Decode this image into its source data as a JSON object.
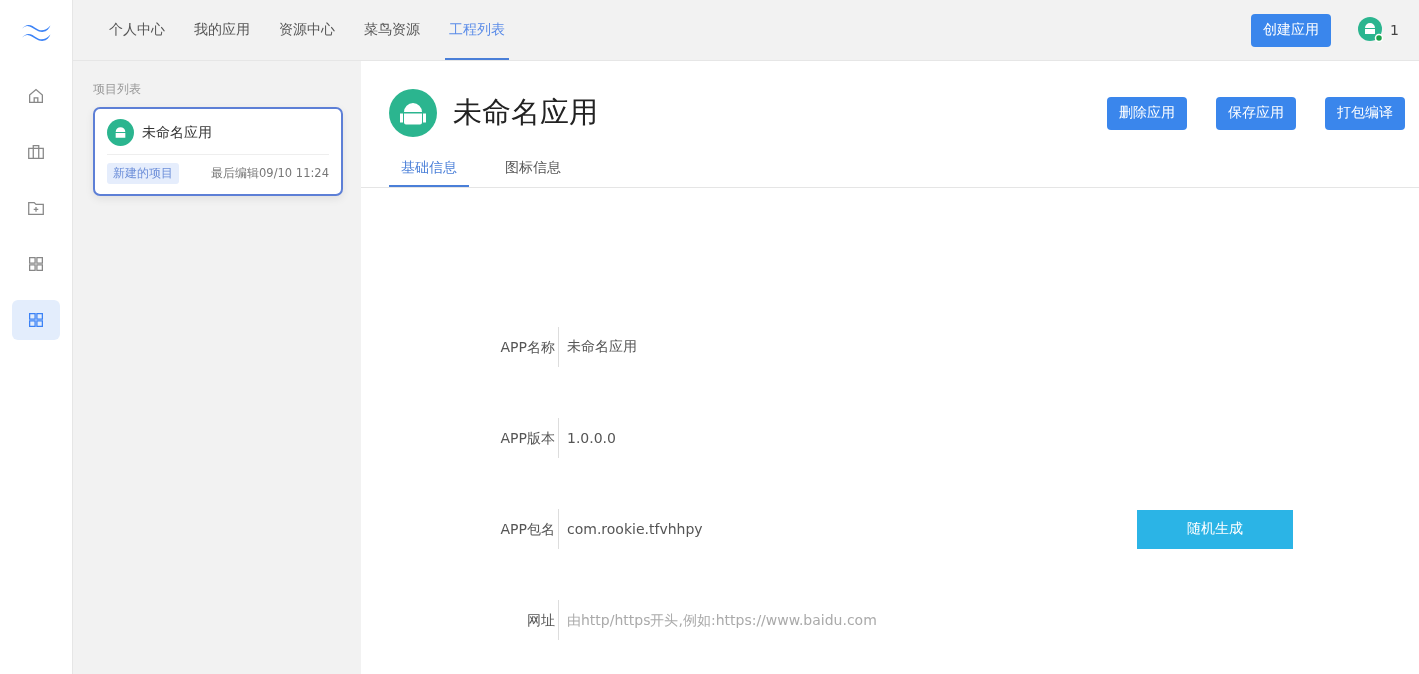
{
  "top_nav": {
    "items": [
      {
        "label": "个人中心",
        "selected": false
      },
      {
        "label": "我的应用",
        "selected": false
      },
      {
        "label": "资源中心",
        "selected": false
      },
      {
        "label": "菜鸟资源",
        "selected": false
      },
      {
        "label": "工程列表",
        "selected": true
      }
    ],
    "create_button": "创建应用",
    "user_count": "1"
  },
  "side_rail": [
    {
      "kind": "home",
      "selected": false
    },
    {
      "kind": "briefcase",
      "selected": false
    },
    {
      "kind": "folder",
      "selected": false
    },
    {
      "kind": "grid",
      "selected": false
    },
    {
      "kind": "grid",
      "selected": true
    }
  ],
  "project_list": {
    "title": "项目列表",
    "projects": [
      {
        "name": "未命名应用",
        "tag": "新建的项目",
        "edited": "最后编辑09/10 11:24",
        "selected": true
      }
    ]
  },
  "app": {
    "title": "未命名应用",
    "buttons": [
      "删除应用",
      "保存应用",
      "打包编译"
    ],
    "tabs": [
      {
        "label": "基础信息",
        "selected": true
      },
      {
        "label": "图标信息",
        "selected": false
      }
    ],
    "form": [
      {
        "label": "APP名称",
        "value": "未命名应用"
      },
      {
        "label": "APP版本",
        "value": "1.0.0.0"
      },
      {
        "label": "APP包名",
        "value": "com.rookie.tfvhhpy",
        "button": "随机生成"
      },
      {
        "label": "网址",
        "placeholder": "由http/https开头,例如:https://www.baidu.com"
      }
    ]
  }
}
